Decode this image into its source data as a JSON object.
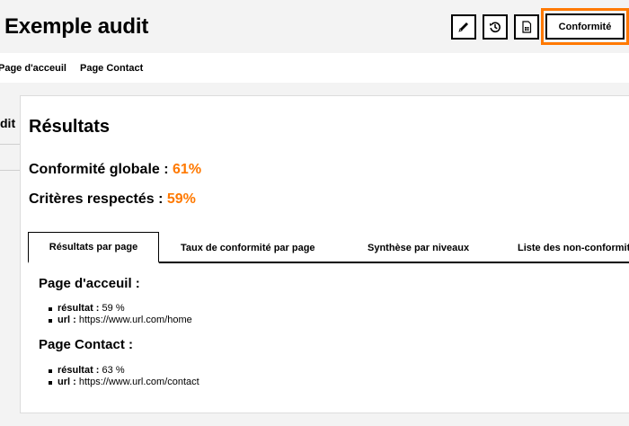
{
  "header": {
    "title": "Exemple audit",
    "actions": {
      "edit_icon": "pencil-icon",
      "history_icon": "history-icon",
      "export_icon": "spreadsheet-icon",
      "conformite_label": "Conformité"
    },
    "accent_color": "#ff7900"
  },
  "page_nav": {
    "items": [
      "Page d'acceuil",
      "Page Contact"
    ]
  },
  "side_panel": {
    "label": "dit"
  },
  "results": {
    "title": "Résultats",
    "global_label": "Conformité globale :",
    "global_value": "61%",
    "criteria_label": "Critères respectés :",
    "criteria_value": "59%"
  },
  "tabs": [
    "Résultats par page",
    "Taux de conformité par page",
    "Synthèse par niveaux",
    "Liste des non-conformit"
  ],
  "pages": [
    {
      "title": "Page d'acceuil :",
      "result_label": "résultat :",
      "result_value": "59 %",
      "url_label": "url :",
      "url_value": "https://www.url.com/home"
    },
    {
      "title": "Page Contact :",
      "result_label": "résultat :",
      "result_value": "63 %",
      "url_label": "url :",
      "url_value": "https://www.url.com/contact"
    }
  ]
}
